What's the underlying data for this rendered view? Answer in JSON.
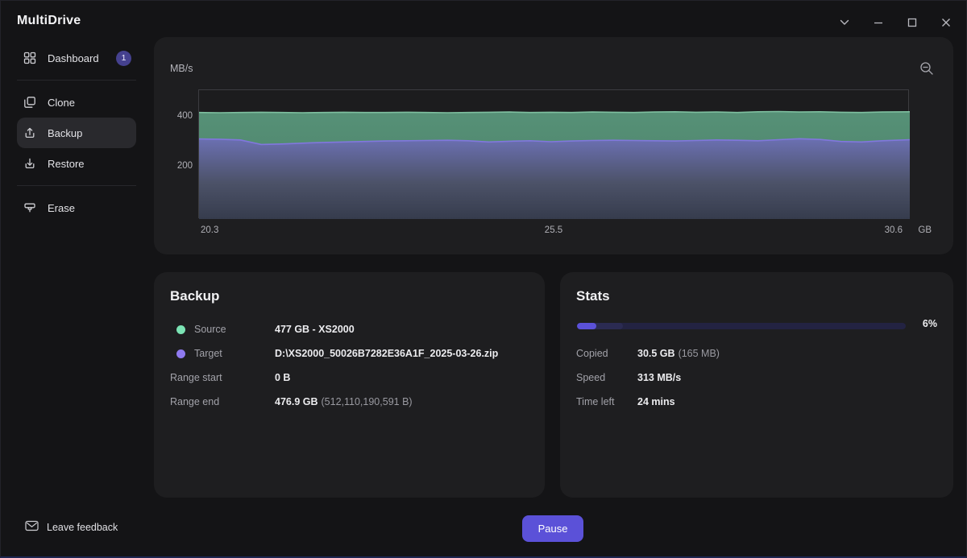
{
  "window": {
    "title": "MultiDrive",
    "controls": {
      "menu": "chevron-down",
      "minimize": "minimize",
      "maximize": "maximize",
      "close": "close"
    }
  },
  "sidebar": {
    "items": [
      {
        "label": "Dashboard",
        "badge": "1",
        "selected": false
      },
      {
        "label": "Clone",
        "selected": false
      },
      {
        "label": "Backup",
        "selected": true
      },
      {
        "label": "Restore",
        "selected": false
      },
      {
        "label": "Erase",
        "selected": false
      }
    ]
  },
  "chart": {
    "y_unit": "MB/s",
    "x_unit": "GB",
    "y_ticks": {
      "t400": "400",
      "t200": "200"
    },
    "x_ticks": {
      "left": "20.3",
      "mid": "25.5",
      "right": "30.6"
    },
    "zoom_control": "zoom-out"
  },
  "chart_data": {
    "type": "area",
    "xlabel": "GB",
    "ylabel": "MB/s",
    "x_range": [
      20.3,
      30.6
    ],
    "ylim": [
      0,
      520
    ],
    "y_tick_values": [
      200,
      400
    ],
    "x_tick_values": [
      20.3,
      25.5,
      30.6
    ],
    "grid": false,
    "legend_position": "none",
    "x": [
      20.3,
      20.6,
      20.9,
      21.2,
      21.5,
      21.8,
      22.1,
      22.4,
      22.7,
      23.0,
      23.3,
      23.6,
      23.9,
      24.2,
      24.5,
      24.8,
      25.1,
      25.4,
      25.7,
      26.0,
      26.3,
      26.6,
      26.9,
      27.2,
      27.5,
      27.8,
      28.1,
      28.4,
      28.7,
      29.0,
      29.3,
      29.6,
      29.9,
      30.2,
      30.6
    ],
    "series": [
      {
        "name": "Source",
        "color": "#7fc0a0",
        "fill": "gradient-green",
        "values": [
          430,
          429,
          430,
          431,
          430,
          429,
          430,
          431,
          430,
          430,
          431,
          430,
          429,
          430,
          431,
          432,
          430,
          431,
          430,
          432,
          431,
          430,
          432,
          433,
          431,
          432,
          430,
          433,
          434,
          432,
          433,
          431,
          430,
          432,
          433
        ]
      },
      {
        "name": "Target",
        "color": "#8177dd",
        "fill": "gradient-purple",
        "values": [
          323,
          322,
          319,
          301,
          303,
          306,
          309,
          311,
          313,
          315,
          316,
          317,
          318,
          316,
          311,
          314,
          316,
          312,
          315,
          317,
          318,
          317,
          316,
          315,
          317,
          319,
          318,
          316,
          320,
          324,
          321,
          313,
          311,
          316,
          320
        ]
      }
    ]
  },
  "backup_card": {
    "title": "Backup",
    "rows": [
      {
        "label": "Source",
        "value": "477 GB - XS2000"
      },
      {
        "label": "Target",
        "value": "D:\\XS2000_50026B7282E36A1F_2025-03-26.zip"
      },
      {
        "label": "Range start",
        "value": "0 B"
      },
      {
        "label": "Range end",
        "value": "476.9 GB",
        "sub": "(512,110,190,591 B)"
      }
    ]
  },
  "stats_card": {
    "title": "Stats",
    "progress": {
      "percent": 6,
      "buffer_percent": 14,
      "label": "6%"
    },
    "rows": [
      {
        "label": "Copied",
        "value": "30.5 GB",
        "sub": "(165 MB)"
      },
      {
        "label": "Speed",
        "value": "313 MB/s"
      },
      {
        "label": "Time left",
        "value": "24 mins"
      }
    ]
  },
  "footer": {
    "feedback_label": "Leave feedback",
    "pause_label": "Pause"
  },
  "colors": {
    "accent": "#5b51d8",
    "source_dot": "#7be3b4",
    "target_dot": "#8f7af0",
    "source_line": "#7fc0a0",
    "target_line": "#8177dd",
    "progress_track": "#232342",
    "badge_bg": "#45418f"
  }
}
